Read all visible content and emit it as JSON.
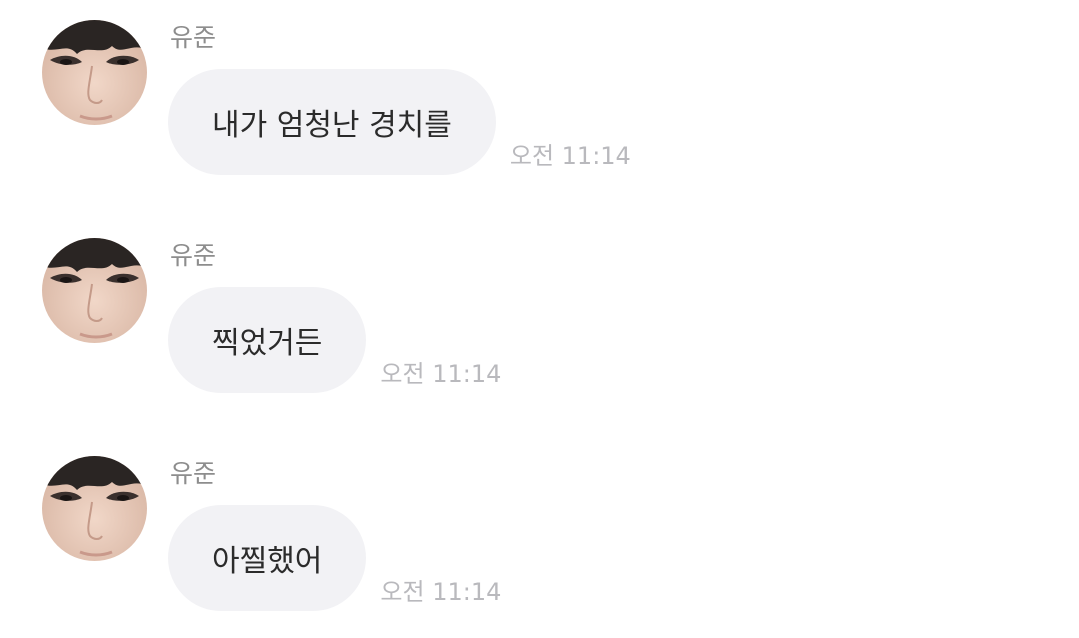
{
  "messages": [
    {
      "sender": "유준",
      "text": "내가 엄청난 경치를",
      "time": "오전 11:14"
    },
    {
      "sender": "유준",
      "text": "찍었거든",
      "time": "오전 11:14"
    },
    {
      "sender": "유준",
      "text": "아찔했어",
      "time": "오전 11:14"
    }
  ],
  "colors": {
    "bubble": "#f2f2f5",
    "sender": "#8d8d8d",
    "time": "#b9b9bd",
    "text": "#2b2b2b"
  }
}
